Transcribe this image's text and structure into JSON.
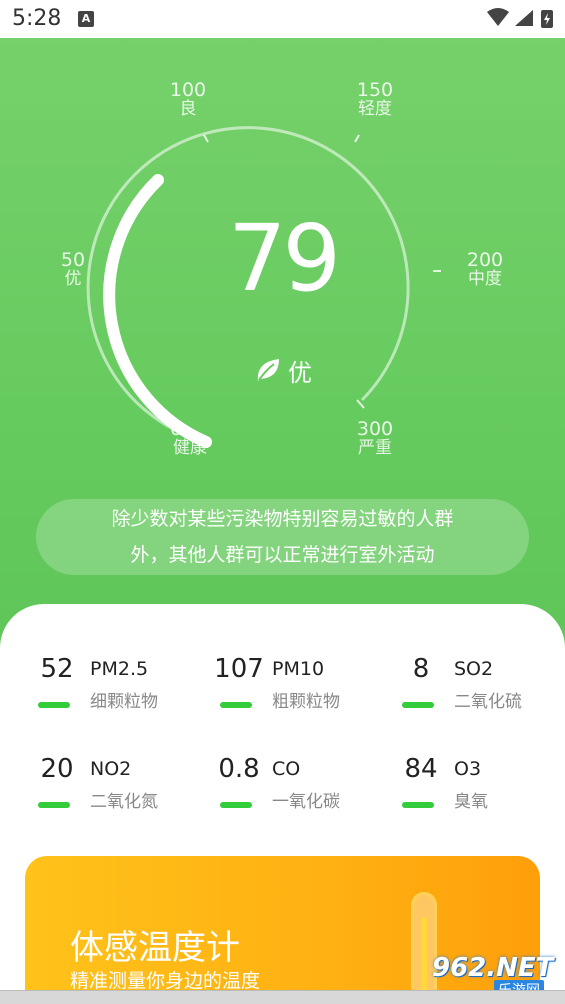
{
  "status_bar": {
    "time": "5:28",
    "notification_badge": "A"
  },
  "gauge": {
    "value": "79",
    "level": "优",
    "progress_fraction": 0.26,
    "scale": [
      {
        "num": "0",
        "text": "健康"
      },
      {
        "num": "50",
        "text": "优"
      },
      {
        "num": "100",
        "text": "良"
      },
      {
        "num": "150",
        "text": "轻度"
      },
      {
        "num": "200",
        "text": "中度"
      },
      {
        "num": "300",
        "text": "严重"
      }
    ]
  },
  "advice": {
    "line1": "除少数对某些污染物特别容易过敏的人群",
    "line2": "外，其他人群可以正常进行室外活动"
  },
  "pollutants": [
    {
      "value": "52",
      "code": "PM2.5",
      "name": "细颗粒物"
    },
    {
      "value": "107",
      "code": "PM10",
      "name": "粗颗粒物"
    },
    {
      "value": "8",
      "code": "SO2",
      "name": "二氧化硫"
    },
    {
      "value": "20",
      "code": "NO2",
      "name": "二氧化氮"
    },
    {
      "value": "0.8",
      "code": "CO",
      "name": "一氧化碳"
    },
    {
      "value": "84",
      "code": "O3",
      "name": "臭氧"
    }
  ],
  "banner": {
    "title": "体感温度计",
    "subtitle": "精准测量你身边的温度"
  },
  "watermark": {
    "brand": "962.NET",
    "sub": "乐游网"
  },
  "colors": {
    "primary_green": "#66cb5f",
    "indicator_green": "#33cc3a",
    "banner_orange": "#ffb012"
  }
}
